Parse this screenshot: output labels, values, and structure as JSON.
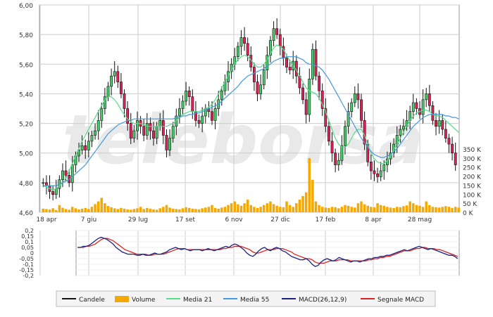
{
  "chart_data": [
    {
      "type": "candlestick",
      "y_ticks": [
        "6,00",
        "5,80",
        "5,60",
        "5,40",
        "5,20",
        "5,00",
        "4,80",
        "4,60"
      ],
      "ylim": [
        4.6,
        6.0
      ],
      "x_ticks": [
        "18 apr",
        "7 giu",
        "29 lug",
        "17 set",
        "6 nov",
        "27 dic",
        "17 feb",
        "8 apr",
        "28 mag"
      ],
      "grid": true,
      "watermark": "teleborsa",
      "candles_close": [
        4.8,
        4.78,
        4.74,
        4.72,
        4.76,
        4.82,
        4.88,
        4.85,
        4.8,
        4.92,
        4.98,
        5.02,
        5.05,
        5.02,
        5.08,
        5.12,
        5.15,
        5.22,
        5.3,
        5.38,
        5.45,
        5.52,
        5.55,
        5.48,
        5.4,
        5.3,
        5.2,
        5.1,
        5.15,
        5.22,
        5.18,
        5.12,
        5.2,
        5.15,
        5.1,
        5.18,
        5.22,
        5.12,
        5.02,
        5.1,
        5.18,
        5.25,
        5.3,
        5.35,
        5.42,
        5.38,
        5.28,
        5.22,
        5.2,
        5.25,
        5.3,
        5.28,
        5.22,
        5.3,
        5.36,
        5.42,
        5.48,
        5.55,
        5.6,
        5.65,
        5.72,
        5.78,
        5.74,
        5.66,
        5.58,
        5.48,
        5.4,
        5.46,
        5.56,
        5.66,
        5.76,
        5.84,
        5.8,
        5.72,
        5.64,
        5.58,
        5.56,
        5.62,
        5.52,
        5.44,
        5.36,
        5.26,
        5.5,
        5.7,
        5.52,
        5.42,
        5.3,
        5.18,
        5.08,
        5.0,
        4.92,
        4.95,
        5.05,
        5.18,
        5.28,
        5.34,
        5.4,
        5.36,
        5.22,
        5.06,
        4.94,
        4.88,
        4.86,
        4.84,
        4.88,
        4.92,
        4.96,
        5.0,
        5.06,
        5.12,
        5.16,
        5.18,
        5.22,
        5.28,
        5.34,
        5.3,
        5.26,
        5.36,
        5.4,
        5.32,
        5.22,
        5.18,
        5.22,
        5.16,
        5.1,
        5.06,
        5.0,
        4.92
      ],
      "volume_y_ticks": [
        "350 K",
        "300 K",
        "250 K",
        "200 K",
        "150 K",
        "100 K",
        "50 K",
        "0 K"
      ],
      "volume_max": 350,
      "volume": [
        20,
        18,
        15,
        22,
        12,
        40,
        25,
        18,
        14,
        30,
        22,
        16,
        20,
        24,
        18,
        30,
        45,
        60,
        80,
        50,
        35,
        28,
        22,
        18,
        24,
        20,
        16,
        14,
        18,
        22,
        30,
        18,
        24,
        20,
        16,
        14,
        22,
        30,
        40,
        26,
        20,
        18,
        16,
        22,
        28,
        24,
        20,
        18,
        16,
        22,
        26,
        30,
        40,
        24,
        20,
        26,
        30,
        40,
        50,
        60,
        44,
        36,
        50,
        70,
        40,
        30,
        24,
        30,
        40,
        50,
        60,
        45,
        36,
        30,
        28,
        60,
        40,
        30,
        50,
        70,
        90,
        110,
        300,
        180,
        60,
        40,
        30,
        26,
        24,
        30,
        28,
        22,
        30,
        40,
        36,
        30,
        26,
        50,
        60,
        44,
        36,
        30,
        28,
        50,
        40,
        36,
        30,
        26,
        24,
        30,
        28,
        34,
        38,
        60,
        50,
        40,
        36,
        30,
        60,
        40,
        30,
        28,
        26,
        30,
        34,
        30,
        24,
        30,
        26
      ],
      "ma21": [
        4.78,
        4.77,
        4.76,
        4.75,
        4.76,
        4.78,
        4.8,
        4.83,
        4.88,
        4.93,
        4.98,
        5.03,
        5.08,
        5.12,
        5.16,
        5.2,
        5.24,
        5.28,
        5.32,
        5.36,
        5.38,
        5.38,
        5.36,
        5.33,
        5.29,
        5.26,
        5.23,
        5.21,
        5.2,
        5.2,
        5.2,
        5.19,
        5.18,
        5.18,
        5.18,
        5.18,
        5.18,
        5.18,
        5.18,
        5.19,
        5.2,
        5.22,
        5.24,
        5.26,
        5.27,
        5.28,
        5.28,
        5.28,
        5.28,
        5.29,
        5.3,
        5.31,
        5.33,
        5.36,
        5.4,
        5.44,
        5.48,
        5.52,
        5.56,
        5.6,
        5.63,
        5.65,
        5.66,
        5.65,
        5.63,
        5.6,
        5.58,
        5.58,
        5.6,
        5.63,
        5.67,
        5.71,
        5.73,
        5.72,
        5.7,
        5.66,
        5.62,
        5.59,
        5.56,
        5.52,
        5.48,
        5.44,
        5.42,
        5.41,
        5.4,
        5.37,
        5.33,
        5.28,
        5.22,
        5.16,
        5.1,
        5.06,
        5.04,
        5.04,
        5.06,
        5.1,
        5.14,
        5.16,
        5.16,
        5.12,
        5.06,
        5.0,
        4.96,
        4.94,
        4.93,
        4.93,
        4.95,
        4.98,
        5.02,
        5.06,
        5.1,
        5.14,
        5.18,
        5.22,
        5.25,
        5.27,
        5.28,
        5.29,
        5.29,
        5.28,
        5.26,
        5.25,
        5.25,
        5.24,
        5.22,
        5.2,
        5.18,
        5.16,
        5.14
      ],
      "ma55": [
        4.78,
        4.78,
        4.78,
        4.78,
        4.78,
        4.79,
        4.8,
        4.81,
        4.82,
        4.84,
        4.86,
        4.88,
        4.9,
        4.92,
        4.95,
        4.98,
        5.01,
        5.04,
        5.07,
        5.1,
        5.13,
        5.15,
        5.17,
        5.19,
        5.2,
        5.21,
        5.22,
        5.22,
        5.23,
        5.23,
        5.23,
        5.23,
        5.23,
        5.23,
        5.23,
        5.23,
        5.23,
        5.23,
        5.23,
        5.23,
        5.23,
        5.24,
        5.24,
        5.25,
        5.25,
        5.26,
        5.26,
        5.27,
        5.27,
        5.28,
        5.29,
        5.3,
        5.31,
        5.32,
        5.33,
        5.35,
        5.37,
        5.39,
        5.41,
        5.43,
        5.45,
        5.48,
        5.5,
        5.52,
        5.53,
        5.54,
        5.55,
        5.56,
        5.57,
        5.59,
        5.6,
        5.62,
        5.63,
        5.64,
        5.64,
        5.65,
        5.65,
        5.65,
        5.65,
        5.64,
        5.63,
        5.61,
        5.6,
        5.6,
        5.59,
        5.58,
        5.56,
        5.53,
        5.5,
        5.46,
        5.42,
        5.38,
        5.34,
        5.3,
        5.26,
        5.22,
        5.18,
        5.14,
        5.1,
        5.07,
        5.04,
        5.01,
        4.99,
        4.98,
        4.97,
        4.97,
        4.98,
        4.99,
        5.01,
        5.03,
        5.06,
        5.09,
        5.12,
        5.15,
        5.18,
        5.2,
        5.22,
        5.24,
        5.25,
        5.26,
        5.26,
        5.26,
        5.26,
        5.26,
        5.25,
        5.25,
        5.24,
        5.24,
        5.23
      ]
    },
    {
      "type": "line",
      "y_ticks": [
        "0,2",
        "0,15",
        "0,1",
        "0,05",
        "0",
        "-0,05",
        "-0,1",
        "-0,15",
        "-0,2"
      ],
      "ylim": [
        -0.2,
        0.2
      ],
      "macd": [
        0.05,
        0.05,
        0.06,
        0.06,
        0.07,
        0.09,
        0.11,
        0.13,
        0.14,
        0.13,
        0.12,
        0.1,
        0.08,
        0.05,
        0.03,
        0.01,
        0.0,
        -0.01,
        -0.01,
        -0.01,
        -0.02,
        -0.02,
        -0.01,
        -0.02,
        -0.02,
        -0.01,
        0.0,
        -0.01,
        -0.01,
        0.0,
        0.01,
        0.03,
        0.04,
        0.05,
        0.04,
        0.03,
        0.04,
        0.03,
        0.02,
        0.03,
        0.03,
        0.03,
        0.02,
        0.03,
        0.04,
        0.03,
        0.02,
        0.03,
        0.04,
        0.05,
        0.06,
        0.05,
        0.07,
        0.08,
        0.07,
        0.05,
        0.03,
        0.0,
        -0.02,
        -0.03,
        -0.01,
        0.02,
        0.04,
        0.05,
        0.03,
        0.02,
        0.04,
        0.05,
        0.04,
        0.02,
        0.01,
        -0.01,
        -0.03,
        -0.04,
        -0.05,
        -0.06,
        -0.06,
        -0.05,
        -0.07,
        -0.1,
        -0.12,
        -0.11,
        -0.08,
        -0.06,
        -0.05,
        -0.06,
        -0.07,
        -0.06,
        -0.04,
        -0.05,
        -0.06,
        -0.07,
        -0.08,
        -0.07,
        -0.07,
        -0.08,
        -0.07,
        -0.06,
        -0.05,
        -0.05,
        -0.04,
        -0.04,
        -0.03,
        -0.03,
        -0.02,
        -0.02,
        -0.01,
        0.0,
        0.01,
        0.02,
        0.03,
        0.02,
        0.03,
        0.04,
        0.05,
        0.06,
        0.05,
        0.04,
        0.03,
        0.04,
        0.03,
        0.02,
        0.01,
        0.0,
        -0.01,
        -0.02,
        -0.02,
        -0.03,
        -0.05
      ],
      "signal": [
        0.05,
        0.05,
        0.05,
        0.06,
        0.06,
        0.07,
        0.08,
        0.1,
        0.12,
        0.13,
        0.13,
        0.12,
        0.11,
        0.09,
        0.07,
        0.05,
        0.03,
        0.02,
        0.01,
        0.0,
        -0.01,
        -0.01,
        -0.01,
        -0.01,
        -0.02,
        -0.02,
        -0.01,
        -0.01,
        -0.01,
        -0.01,
        0.0,
        0.01,
        0.02,
        0.03,
        0.04,
        0.04,
        0.04,
        0.03,
        0.03,
        0.03,
        0.03,
        0.03,
        0.03,
        0.03,
        0.03,
        0.03,
        0.03,
        0.03,
        0.03,
        0.04,
        0.04,
        0.05,
        0.05,
        0.06,
        0.06,
        0.06,
        0.05,
        0.04,
        0.03,
        0.01,
        0.0,
        0.0,
        0.01,
        0.02,
        0.03,
        0.03,
        0.03,
        0.04,
        0.04,
        0.04,
        0.03,
        0.02,
        0.01,
        -0.01,
        -0.02,
        -0.03,
        -0.04,
        -0.05,
        -0.05,
        -0.06,
        -0.08,
        -0.09,
        -0.09,
        -0.09,
        -0.08,
        -0.07,
        -0.07,
        -0.07,
        -0.06,
        -0.06,
        -0.06,
        -0.06,
        -0.07,
        -0.07,
        -0.07,
        -0.07,
        -0.07,
        -0.07,
        -0.06,
        -0.06,
        -0.05,
        -0.05,
        -0.04,
        -0.04,
        -0.03,
        -0.03,
        -0.02,
        -0.01,
        0.0,
        0.01,
        0.02,
        0.02,
        0.02,
        0.03,
        0.04,
        0.04,
        0.05,
        0.05,
        0.04,
        0.04,
        0.04,
        0.03,
        0.03,
        0.02,
        0.01,
        0.0,
        -0.01,
        -0.02,
        -0.03
      ]
    }
  ],
  "colors": {
    "candle": "#111111",
    "volume": "#f5a800",
    "ma21": "#55dd88",
    "ma55": "#4499dd",
    "macd": "#1a237e",
    "signal": "#dd2222",
    "grid": "#cccccc",
    "axis_text": "#333333",
    "legend_border": "#bbbbbb",
    "legend_bg": "#f4f4f4"
  },
  "legend": [
    {
      "label": "Candele",
      "kind": "candle",
      "color": "#111111"
    },
    {
      "label": "Volume",
      "kind": "volume",
      "color": "#f5a800"
    },
    {
      "label": "Media 21",
      "kind": "ma21",
      "color": "#55dd88"
    },
    {
      "label": "Media 55",
      "kind": "ma55",
      "color": "#4499dd"
    },
    {
      "label": "MACD(26,12,9)",
      "kind": "macd",
      "color": "#1a237e"
    },
    {
      "label": "Segnale MACD",
      "kind": "signal",
      "color": "#dd2222"
    }
  ]
}
